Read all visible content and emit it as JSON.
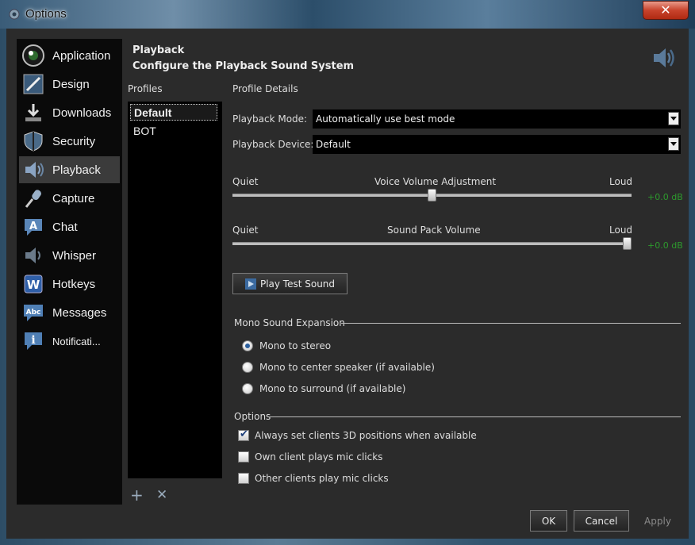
{
  "window": {
    "title": "Options",
    "close_label": "✕"
  },
  "sidebar": {
    "items": [
      {
        "label": "Application",
        "icon": "application-icon"
      },
      {
        "label": "Design",
        "icon": "design-icon"
      },
      {
        "label": "Downloads",
        "icon": "downloads-icon"
      },
      {
        "label": "Security",
        "icon": "shield-icon"
      },
      {
        "label": "Playback",
        "icon": "speaker-icon",
        "active": true
      },
      {
        "label": "Capture",
        "icon": "microphone-icon"
      },
      {
        "label": "Chat",
        "icon": "chat-icon"
      },
      {
        "label": "Whisper",
        "icon": "whisper-icon"
      },
      {
        "label": "Hotkeys",
        "icon": "hotkeys-icon"
      },
      {
        "label": "Messages",
        "icon": "messages-icon"
      },
      {
        "label": "Notificati...",
        "icon": "info-icon"
      }
    ]
  },
  "header": {
    "title": "Playback",
    "subtitle": "Configure the Playback Sound System"
  },
  "profiles": {
    "label": "Profiles",
    "items": [
      {
        "label": "Default",
        "selected": true
      },
      {
        "label": "BOT"
      }
    ],
    "add_label": "+",
    "remove_label": "✕"
  },
  "details": {
    "label": "Profile Details",
    "mode": {
      "label": "Playback Mode:",
      "value": "Automatically use best mode"
    },
    "device": {
      "label": "Playback Device:",
      "value": "Default"
    },
    "voice_volume": {
      "title": "Voice Volume Adjustment",
      "min_label": "Quiet",
      "max_label": "Loud",
      "readout": "+0.0 dB",
      "position": 0.5
    },
    "pack_volume": {
      "title": "Sound Pack Volume",
      "min_label": "Quiet",
      "max_label": "Loud",
      "readout": "+0.0 dB",
      "position": 1.0
    },
    "test_button": "Play Test Sound"
  },
  "mono": {
    "title": "Mono Sound Expansion",
    "options": [
      {
        "label": "Mono to stereo",
        "checked": true
      },
      {
        "label": "Mono to center speaker (if available)",
        "checked": false
      },
      {
        "label": "Mono to surround (if available)",
        "checked": false
      }
    ]
  },
  "options": {
    "title": "Options",
    "items": [
      {
        "label": "Always set clients 3D positions when available",
        "checked": true
      },
      {
        "label": "Own client plays mic clicks",
        "checked": false
      },
      {
        "label": "Other clients play mic clicks",
        "checked": false
      }
    ]
  },
  "footer": {
    "ok": "OK",
    "cancel": "Cancel",
    "apply": "Apply"
  },
  "colors": {
    "accent": "#2b5f9e",
    "db_readout": "#2d9a2d",
    "panel": "#2b2b2b",
    "sidebar": "#0a0a0a"
  }
}
